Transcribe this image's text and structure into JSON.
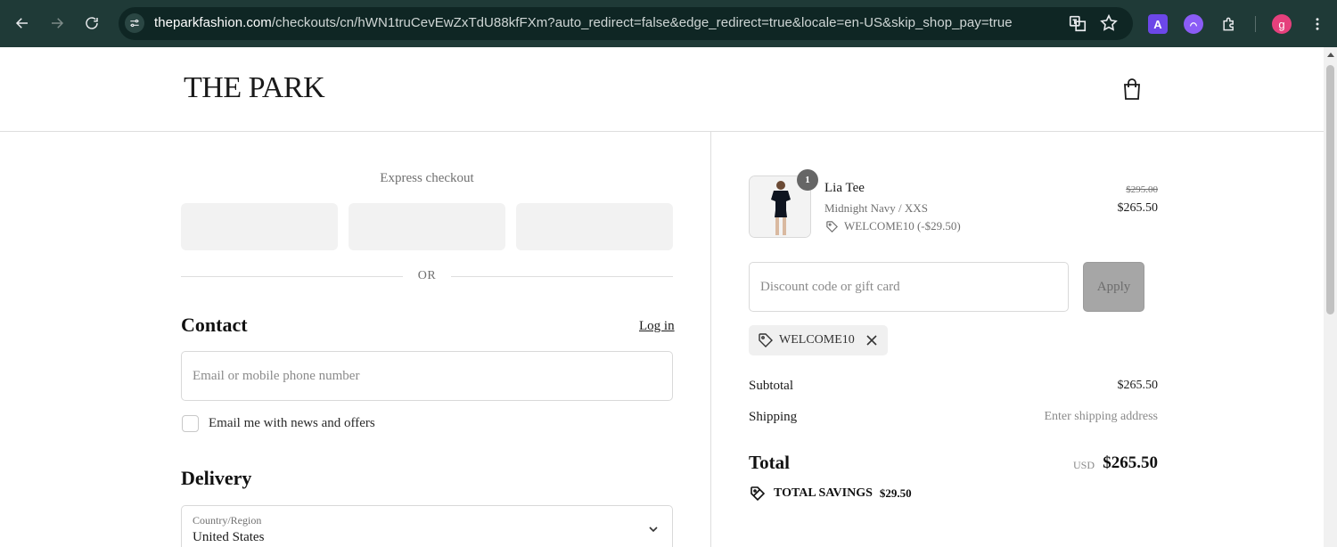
{
  "browser": {
    "url_host": "theparkfashion.com",
    "url_rest": "/checkouts/cn/hWN1truCevEwZxTdU88kfFXm?auto_redirect=false&edge_redirect=true&locale=en-US&skip_shop_pay=true",
    "avatar_letter": "g",
    "extension_a_label": "A"
  },
  "header": {
    "logo": "THE PARK"
  },
  "checkout": {
    "express_label": "Express checkout",
    "or_label": "OR",
    "contact_title": "Contact",
    "login_label": "Log in",
    "email_placeholder": "Email or mobile phone number",
    "newsletter_label": "Email me with news and offers",
    "delivery_title": "Delivery",
    "country_label": "Country/Region",
    "country_value": "United States"
  },
  "order": {
    "quantity": "1",
    "product_name": "Lia Tee",
    "variant": "Midnight Navy / XXS",
    "discount_line": "WELCOME10 (-$29.50)",
    "original_price": "$295.00",
    "price": "$265.50",
    "discount_placeholder": "Discount code or gift card",
    "apply_label": "Apply",
    "applied_code": "WELCOME10",
    "subtotal_label": "Subtotal",
    "subtotal_value": "$265.50",
    "shipping_label": "Shipping",
    "shipping_value": "Enter shipping address",
    "total_label": "Total",
    "total_currency": "USD",
    "total_value": "$265.50",
    "savings_label": "TOTAL SAVINGS",
    "savings_value": "$29.50"
  }
}
